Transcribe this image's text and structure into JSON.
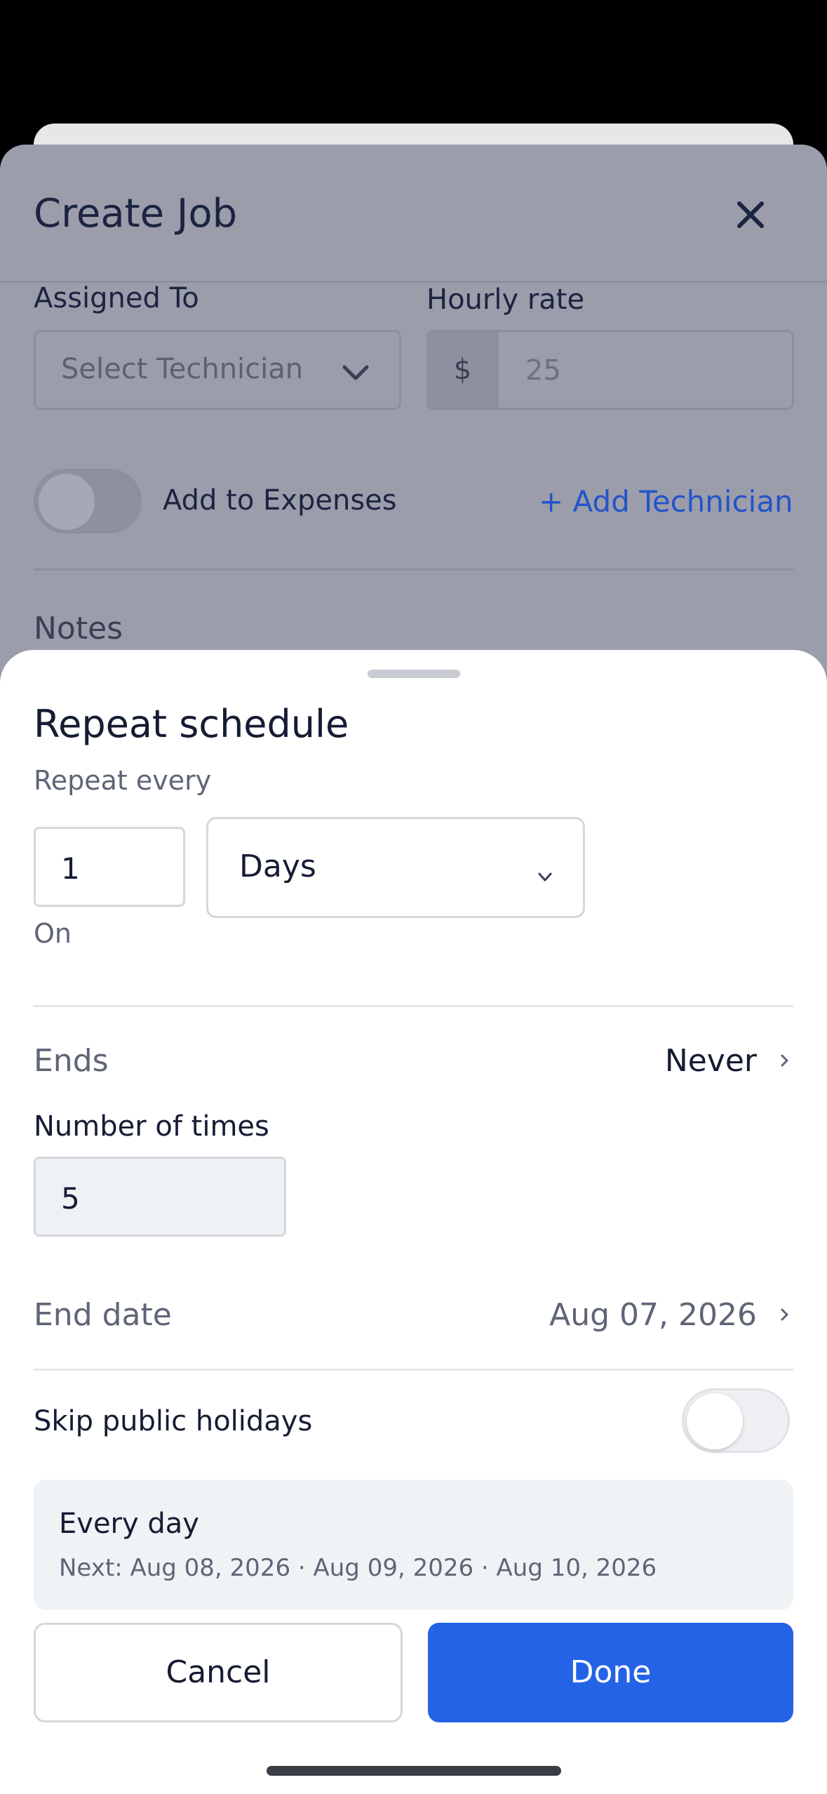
{
  "background": {
    "title": "Create Job",
    "assigned_to_label": "Assigned To",
    "assigned_to_placeholder": "Select Technician",
    "hourly_rate_label": "Hourly rate",
    "hourly_rate_prefix": "$",
    "hourly_rate_value": "25",
    "add_to_expenses_label": "Add to Expenses",
    "add_technician_label": "+ Add Technician",
    "notes_label": "Notes"
  },
  "sheet": {
    "title": "Repeat schedule",
    "repeat_every_label": "Repeat every",
    "interval_value": "1",
    "unit_value": "Days",
    "on_label": "On",
    "ends_label": "Ends",
    "ends_value": "Never",
    "number_of_times_label": "Number of times",
    "number_of_times_value": "5",
    "end_date_label": "End date",
    "end_date_value": "Aug 07, 2026",
    "skip_holidays_label": "Skip public holidays",
    "skip_holidays_on": false,
    "summary_title": "Every day",
    "summary_next": "Next: Aug 08, 2026 · Aug 09, 2026 · Aug 10, 2026",
    "cancel_label": "Cancel",
    "done_label": "Done"
  },
  "colors": {
    "accent": "#2563e6",
    "link": "#2354c9",
    "overlay": "#9b9dab"
  },
  "icons": {
    "close": "close-icon",
    "dropdown": "chevron-down-icon",
    "disclosure": "chevron-right-icon"
  }
}
